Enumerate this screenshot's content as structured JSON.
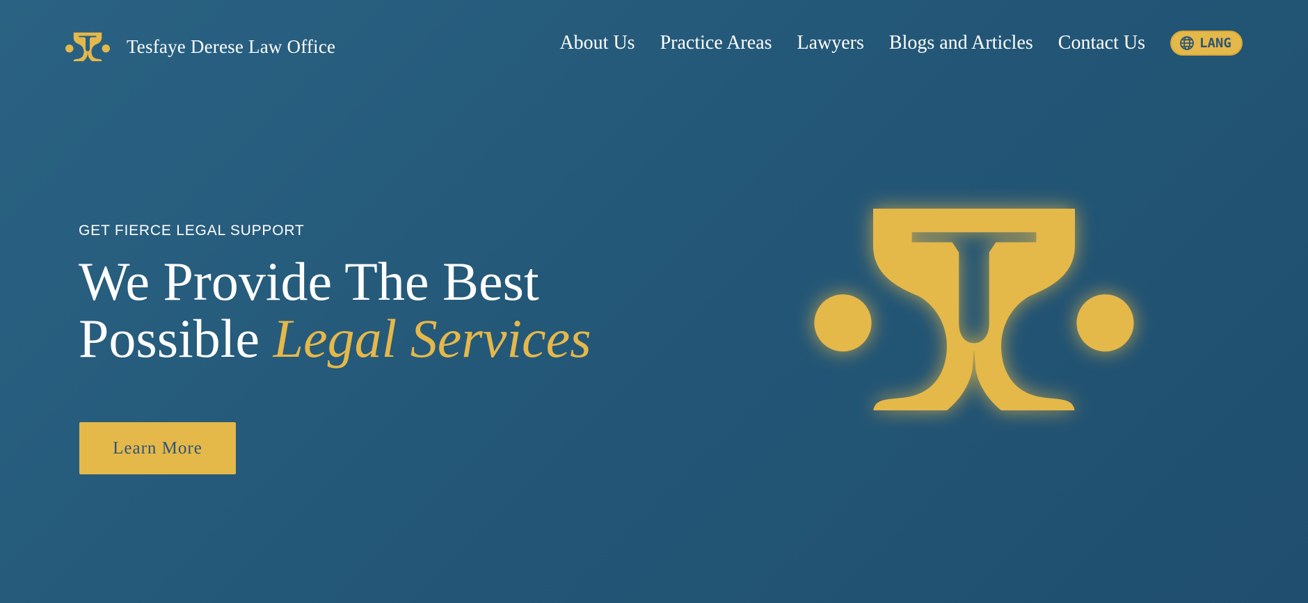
{
  "brand": {
    "name": "Tesfaye Derese Law Office",
    "logo_icon": "tdlo-emblem-icon",
    "accent_color": "#e5b84a",
    "background_color": "#245878"
  },
  "nav": {
    "items": [
      {
        "label": "About Us"
      },
      {
        "label": "Practice Areas"
      },
      {
        "label": "Lawyers"
      },
      {
        "label": "Blogs and Articles"
      },
      {
        "label": "Contact Us"
      }
    ],
    "lang": {
      "label": "LANG",
      "icon": "globe-icon"
    }
  },
  "hero": {
    "eyebrow": "GET FIERCE LEGAL SUPPORT",
    "headline_line1": "We Provide The Best",
    "headline_line2_plain": "Possible",
    "headline_line2_accent": "Legal Services",
    "cta_label": "Learn More"
  }
}
